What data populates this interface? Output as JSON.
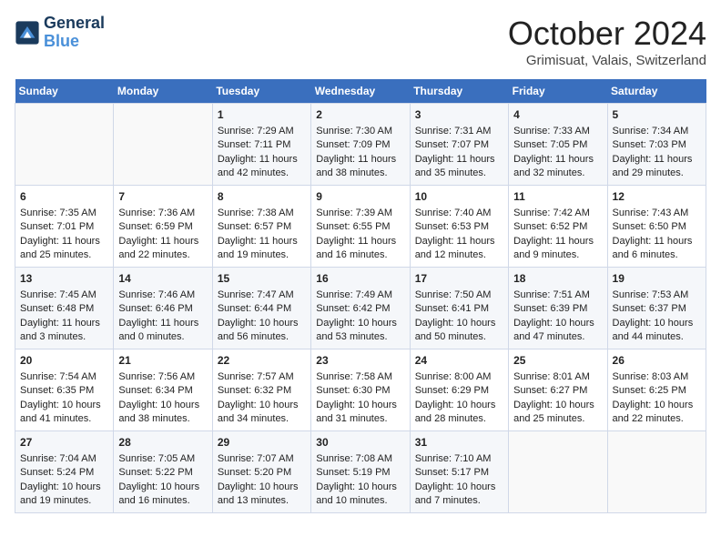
{
  "header": {
    "logo_line1": "General",
    "logo_line2": "Blue",
    "month": "October 2024",
    "location": "Grimisuat, Valais, Switzerland"
  },
  "days_of_week": [
    "Sunday",
    "Monday",
    "Tuesday",
    "Wednesday",
    "Thursday",
    "Friday",
    "Saturday"
  ],
  "weeks": [
    [
      {
        "day": "",
        "sunrise": "",
        "sunset": "",
        "daylight": ""
      },
      {
        "day": "",
        "sunrise": "",
        "sunset": "",
        "daylight": ""
      },
      {
        "day": "1",
        "sunrise": "Sunrise: 7:29 AM",
        "sunset": "Sunset: 7:11 PM",
        "daylight": "Daylight: 11 hours and 42 minutes."
      },
      {
        "day": "2",
        "sunrise": "Sunrise: 7:30 AM",
        "sunset": "Sunset: 7:09 PM",
        "daylight": "Daylight: 11 hours and 38 minutes."
      },
      {
        "day": "3",
        "sunrise": "Sunrise: 7:31 AM",
        "sunset": "Sunset: 7:07 PM",
        "daylight": "Daylight: 11 hours and 35 minutes."
      },
      {
        "day": "4",
        "sunrise": "Sunrise: 7:33 AM",
        "sunset": "Sunset: 7:05 PM",
        "daylight": "Daylight: 11 hours and 32 minutes."
      },
      {
        "day": "5",
        "sunrise": "Sunrise: 7:34 AM",
        "sunset": "Sunset: 7:03 PM",
        "daylight": "Daylight: 11 hours and 29 minutes."
      }
    ],
    [
      {
        "day": "6",
        "sunrise": "Sunrise: 7:35 AM",
        "sunset": "Sunset: 7:01 PM",
        "daylight": "Daylight: 11 hours and 25 minutes."
      },
      {
        "day": "7",
        "sunrise": "Sunrise: 7:36 AM",
        "sunset": "Sunset: 6:59 PM",
        "daylight": "Daylight: 11 hours and 22 minutes."
      },
      {
        "day": "8",
        "sunrise": "Sunrise: 7:38 AM",
        "sunset": "Sunset: 6:57 PM",
        "daylight": "Daylight: 11 hours and 19 minutes."
      },
      {
        "day": "9",
        "sunrise": "Sunrise: 7:39 AM",
        "sunset": "Sunset: 6:55 PM",
        "daylight": "Daylight: 11 hours and 16 minutes."
      },
      {
        "day": "10",
        "sunrise": "Sunrise: 7:40 AM",
        "sunset": "Sunset: 6:53 PM",
        "daylight": "Daylight: 11 hours and 12 minutes."
      },
      {
        "day": "11",
        "sunrise": "Sunrise: 7:42 AM",
        "sunset": "Sunset: 6:52 PM",
        "daylight": "Daylight: 11 hours and 9 minutes."
      },
      {
        "day": "12",
        "sunrise": "Sunrise: 7:43 AM",
        "sunset": "Sunset: 6:50 PM",
        "daylight": "Daylight: 11 hours and 6 minutes."
      }
    ],
    [
      {
        "day": "13",
        "sunrise": "Sunrise: 7:45 AM",
        "sunset": "Sunset: 6:48 PM",
        "daylight": "Daylight: 11 hours and 3 minutes."
      },
      {
        "day": "14",
        "sunrise": "Sunrise: 7:46 AM",
        "sunset": "Sunset: 6:46 PM",
        "daylight": "Daylight: 11 hours and 0 minutes."
      },
      {
        "day": "15",
        "sunrise": "Sunrise: 7:47 AM",
        "sunset": "Sunset: 6:44 PM",
        "daylight": "Daylight: 10 hours and 56 minutes."
      },
      {
        "day": "16",
        "sunrise": "Sunrise: 7:49 AM",
        "sunset": "Sunset: 6:42 PM",
        "daylight": "Daylight: 10 hours and 53 minutes."
      },
      {
        "day": "17",
        "sunrise": "Sunrise: 7:50 AM",
        "sunset": "Sunset: 6:41 PM",
        "daylight": "Daylight: 10 hours and 50 minutes."
      },
      {
        "day": "18",
        "sunrise": "Sunrise: 7:51 AM",
        "sunset": "Sunset: 6:39 PM",
        "daylight": "Daylight: 10 hours and 47 minutes."
      },
      {
        "day": "19",
        "sunrise": "Sunrise: 7:53 AM",
        "sunset": "Sunset: 6:37 PM",
        "daylight": "Daylight: 10 hours and 44 minutes."
      }
    ],
    [
      {
        "day": "20",
        "sunrise": "Sunrise: 7:54 AM",
        "sunset": "Sunset: 6:35 PM",
        "daylight": "Daylight: 10 hours and 41 minutes."
      },
      {
        "day": "21",
        "sunrise": "Sunrise: 7:56 AM",
        "sunset": "Sunset: 6:34 PM",
        "daylight": "Daylight: 10 hours and 38 minutes."
      },
      {
        "day": "22",
        "sunrise": "Sunrise: 7:57 AM",
        "sunset": "Sunset: 6:32 PM",
        "daylight": "Daylight: 10 hours and 34 minutes."
      },
      {
        "day": "23",
        "sunrise": "Sunrise: 7:58 AM",
        "sunset": "Sunset: 6:30 PM",
        "daylight": "Daylight: 10 hours and 31 minutes."
      },
      {
        "day": "24",
        "sunrise": "Sunrise: 8:00 AM",
        "sunset": "Sunset: 6:29 PM",
        "daylight": "Daylight: 10 hours and 28 minutes."
      },
      {
        "day": "25",
        "sunrise": "Sunrise: 8:01 AM",
        "sunset": "Sunset: 6:27 PM",
        "daylight": "Daylight: 10 hours and 25 minutes."
      },
      {
        "day": "26",
        "sunrise": "Sunrise: 8:03 AM",
        "sunset": "Sunset: 6:25 PM",
        "daylight": "Daylight: 10 hours and 22 minutes."
      }
    ],
    [
      {
        "day": "27",
        "sunrise": "Sunrise: 7:04 AM",
        "sunset": "Sunset: 5:24 PM",
        "daylight": "Daylight: 10 hours and 19 minutes."
      },
      {
        "day": "28",
        "sunrise": "Sunrise: 7:05 AM",
        "sunset": "Sunset: 5:22 PM",
        "daylight": "Daylight: 10 hours and 16 minutes."
      },
      {
        "day": "29",
        "sunrise": "Sunrise: 7:07 AM",
        "sunset": "Sunset: 5:20 PM",
        "daylight": "Daylight: 10 hours and 13 minutes."
      },
      {
        "day": "30",
        "sunrise": "Sunrise: 7:08 AM",
        "sunset": "Sunset: 5:19 PM",
        "daylight": "Daylight: 10 hours and 10 minutes."
      },
      {
        "day": "31",
        "sunrise": "Sunrise: 7:10 AM",
        "sunset": "Sunset: 5:17 PM",
        "daylight": "Daylight: 10 hours and 7 minutes."
      },
      {
        "day": "",
        "sunrise": "",
        "sunset": "",
        "daylight": ""
      },
      {
        "day": "",
        "sunrise": "",
        "sunset": "",
        "daylight": ""
      }
    ]
  ]
}
